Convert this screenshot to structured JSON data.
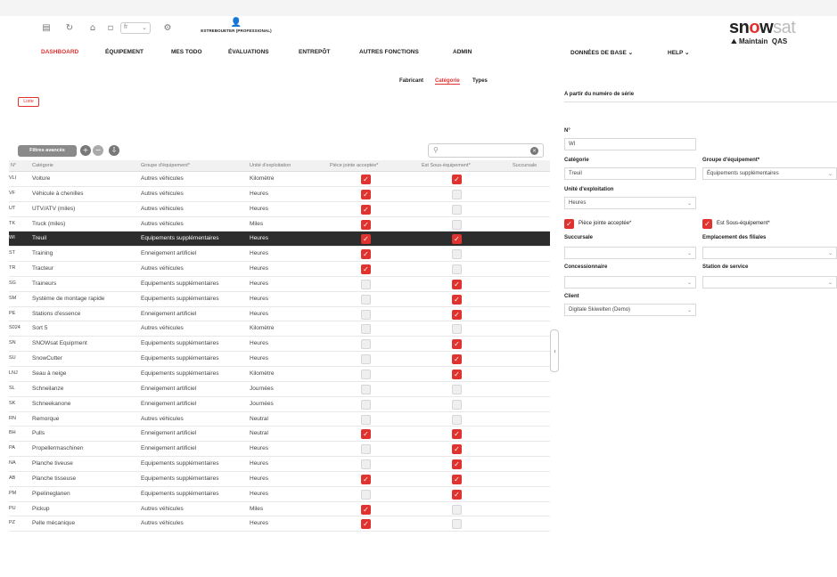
{
  "toolbar": {
    "icons": [
      "grid-icon",
      "refresh-icon",
      "home-icon",
      "language-select",
      "settings-icon"
    ],
    "language_value": "fr",
    "user_name": "ESTREBOUETER (PROFESSIONAL)"
  },
  "nav": {
    "items": [
      {
        "label": "DASHBOARD",
        "active": true
      },
      {
        "label": "ÉQUIPEMENT",
        "active": false
      },
      {
        "label": "MES TODO",
        "active": false
      },
      {
        "label": "ÉVALUATIONS",
        "active": false
      },
      {
        "label": "ENTREPÔT",
        "active": false
      },
      {
        "label": "AUTRES FONCTIONS",
        "active": false
      },
      {
        "label": "ADMIN",
        "active": false
      },
      {
        "label": "DONNÉES DE BASE ⌄",
        "active": false
      },
      {
        "label": "HELP ⌄",
        "active": false
      }
    ]
  },
  "brand": {
    "logo_pre": "sn",
    "logo_o": "o",
    "logo_w": "w",
    "logo_sat": "sat",
    "sub_main": "Maintain",
    "sub_env": "QAS"
  },
  "subtabs": [
    {
      "label": "Fabricant",
      "active": false
    },
    {
      "label": "Catégorie",
      "active": true
    },
    {
      "label": "Types",
      "active": false
    }
  ],
  "liste_label": "Liste",
  "filter_label": "Filtres avancés",
  "search": {
    "value": "",
    "placeholder": ""
  },
  "table": {
    "headers": [
      "N°",
      "Catégorie",
      "Groupe d'équipement*",
      "Unité d'exploitation",
      "Pièce jointe acceptée*",
      "Est Sous-équipement*",
      "Succursale"
    ],
    "rows": [
      {
        "code": "VLI",
        "category": "Voiture",
        "group": "Autres véhicules",
        "unit": "Kilomètre",
        "piece": true,
        "sous": true
      },
      {
        "code": "VF",
        "category": "Véhicule à chenilles",
        "group": "Autres véhicules",
        "unit": "Heures",
        "piece": true,
        "sous": false
      },
      {
        "code": "UT",
        "category": "UTV/ATV (miles)",
        "group": "Autres véhicules",
        "unit": "Heures",
        "piece": true,
        "sous": false
      },
      {
        "code": "TK",
        "category": "Truck (miles)",
        "group": "Autres véhicules",
        "unit": "Miles",
        "piece": true,
        "sous": false
      },
      {
        "code": "WI",
        "category": "Treuil",
        "group": "Équipements supplémentaires",
        "unit": "Heures",
        "piece": true,
        "sous": true,
        "selected": true
      },
      {
        "code": "ST",
        "category": "Training",
        "group": "Enneigement artificiel",
        "unit": "Heures",
        "piece": true,
        "sous": false
      },
      {
        "code": "TR",
        "category": "Tracteur",
        "group": "Autres véhicules",
        "unit": "Heures",
        "piece": true,
        "sous": false
      },
      {
        "code": "SG",
        "category": "Traineurs",
        "group": "Équipements supplémentaires",
        "unit": "Heures",
        "piece": false,
        "sous": true
      },
      {
        "code": "SM",
        "category": "Système de montage rapide",
        "group": "Équipements supplémentaires",
        "unit": "Heures",
        "piece": false,
        "sous": true
      },
      {
        "code": "PE",
        "category": "Stations d'essence",
        "group": "Enneigement artificiel",
        "unit": "Heures",
        "piece": false,
        "sous": true
      },
      {
        "code": "S024",
        "category": "Sort 5",
        "group": "Autres véhicules",
        "unit": "Kilomètre",
        "piece": false,
        "sous": false
      },
      {
        "code": "SN",
        "category": "SNOWsat Equipment",
        "group": "Équipements supplémentaires",
        "unit": "Heures",
        "piece": false,
        "sous": true
      },
      {
        "code": "SU",
        "category": "SnowCutter",
        "group": "Équipements supplémentaires",
        "unit": "Heures",
        "piece": false,
        "sous": true
      },
      {
        "code": "LNJ",
        "category": "Seau à neige",
        "group": "Équipements supplémentaires",
        "unit": "Kilomètre",
        "piece": false,
        "sous": true
      },
      {
        "code": "SL",
        "category": "Schneilanze",
        "group": "Enneigement artificiel",
        "unit": "Journées",
        "piece": false,
        "sous": false
      },
      {
        "code": "SK",
        "category": "Schneekanone",
        "group": "Enneigement artificiel",
        "unit": "Journées",
        "piece": false,
        "sous": false
      },
      {
        "code": "RN",
        "category": "Remorque",
        "group": "Autres véhicules",
        "unit": "Neutral",
        "piece": false,
        "sous": false
      },
      {
        "code": "BH",
        "category": "Pulls",
        "group": "Enneigement artificiel",
        "unit": "Neutral",
        "piece": true,
        "sous": true
      },
      {
        "code": "PA",
        "category": "Propellermaschinen",
        "group": "Enneigement artificiel",
        "unit": "Heures",
        "piece": false,
        "sous": true
      },
      {
        "code": "NA",
        "category": "Planche tiveuse",
        "group": "Équipements supplémentaires",
        "unit": "Heures",
        "piece": false,
        "sous": true
      },
      {
        "code": "AB",
        "category": "Planche tisseuse",
        "group": "Équipements supplémentaires",
        "unit": "Heures",
        "piece": true,
        "sous": true
      },
      {
        "code": "PM",
        "category": "Pipelineglanen",
        "group": "Équipements supplémentaires",
        "unit": "Heures",
        "piece": false,
        "sous": true
      },
      {
        "code": "PU",
        "category": "Pickup",
        "group": "Autres véhicules",
        "unit": "Miles",
        "piece": true,
        "sous": false
      },
      {
        "code": "PZ",
        "category": "Pelle mécanique",
        "group": "Autres véhicules",
        "unit": "Heures",
        "piece": true,
        "sous": false
      }
    ]
  },
  "panel": {
    "title": "A partir du numéro de série",
    "no_label": "N°",
    "no_value": "WI",
    "categorie_label": "Catégorie",
    "categorie_value": "Treuil",
    "groupe_label": "Groupe d'équipement*",
    "groupe_value": "Équipements supplémentaires",
    "unite_label": "Unité d'exploitation",
    "unite_value": "Heures",
    "piece_label": "Pièce jointe acceptée*",
    "sous_label": "Est Sous-équipement*",
    "succursale_label": "Succursale",
    "succursale_value": "",
    "emplacement_label": "Emplacement des filiales",
    "emplacement_value": "",
    "concessionnaire_label": "Concessionnaire",
    "concessionnaire_value": "",
    "station_label": "Station de service",
    "station_value": "",
    "client_label": "Client",
    "client_value": "Digitale Skiwelten (Demo)"
  }
}
